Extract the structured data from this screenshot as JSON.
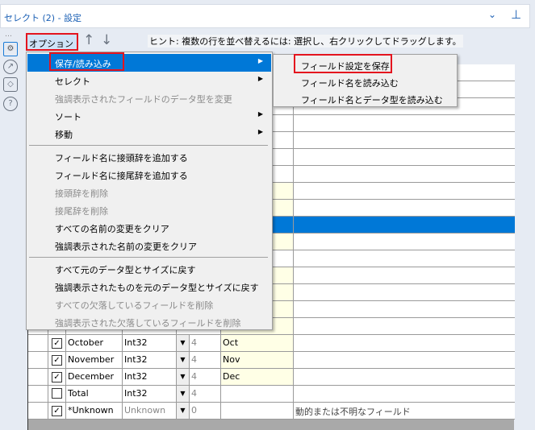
{
  "window": {
    "title": "セレクト (2) - 設定",
    "chevron_icon": "chevron-down-icon",
    "pin_icon": "pin-icon"
  },
  "sidebar": {
    "icons": [
      "gear-icon",
      "arrow-circle-icon",
      "tag-icon",
      "question-icon"
    ]
  },
  "toolbar": {
    "options_label": "オプション ▾",
    "up_icon": "arrow-up-icon",
    "down_icon": "arrow-down-icon",
    "hint": "ヒント: 複数の行を並べ替えるには: 選択し、右クリックしてドラッグします。"
  },
  "menu": {
    "items": [
      {
        "label": "保存/読み込み",
        "submenu": true,
        "highlighted": true
      },
      {
        "label": "セレクト",
        "submenu": true
      },
      {
        "label": "強調表示されたフィールドのデータ型を変更",
        "disabled": true
      },
      {
        "label": "ソート",
        "submenu": true
      },
      {
        "label": "移動",
        "submenu": true
      },
      {
        "separator": true
      },
      {
        "label": "フィールド名に接頭辞を追加する"
      },
      {
        "label": "フィールド名に接尾辞を追加する"
      },
      {
        "label": "接頭辞を削除",
        "disabled": true
      },
      {
        "label": "接尾辞を削除",
        "disabled": true
      },
      {
        "label": "すべての名前の変更をクリア"
      },
      {
        "label": "強調表示された名前の変更をクリア"
      },
      {
        "separator": true
      },
      {
        "label": "すべて元のデータ型とサイズに戻す"
      },
      {
        "label": "強調表示されたものを元のデータ型とサイズに戻す"
      },
      {
        "label": "すべての欠落しているフィールドを削除",
        "disabled": true
      },
      {
        "label": "強調表示された欠落しているフィールドを削除",
        "disabled": true
      }
    ]
  },
  "submenu": {
    "items": [
      "フィールド設定を保存",
      "フィールド名を読み込む",
      "フィールド名とデータ型を読み込む"
    ]
  },
  "grid": {
    "rows": [
      {
        "checked": true,
        "field": "October",
        "type": "Int32",
        "size": "4",
        "rename": "Oct",
        "description": ""
      },
      {
        "checked": true,
        "field": "November",
        "type": "Int32",
        "size": "4",
        "rename": "Nov",
        "description": ""
      },
      {
        "checked": true,
        "field": "December",
        "type": "Int32",
        "size": "4",
        "rename": "Dec",
        "description": ""
      },
      {
        "checked": false,
        "field": "Total",
        "type": "Int32",
        "size": "4",
        "rename": "",
        "description": ""
      },
      {
        "checked": true,
        "field": "*Unknown",
        "type": "Unknown",
        "size": "0",
        "rename": "",
        "description": "動的または不明なフィールド"
      }
    ]
  }
}
